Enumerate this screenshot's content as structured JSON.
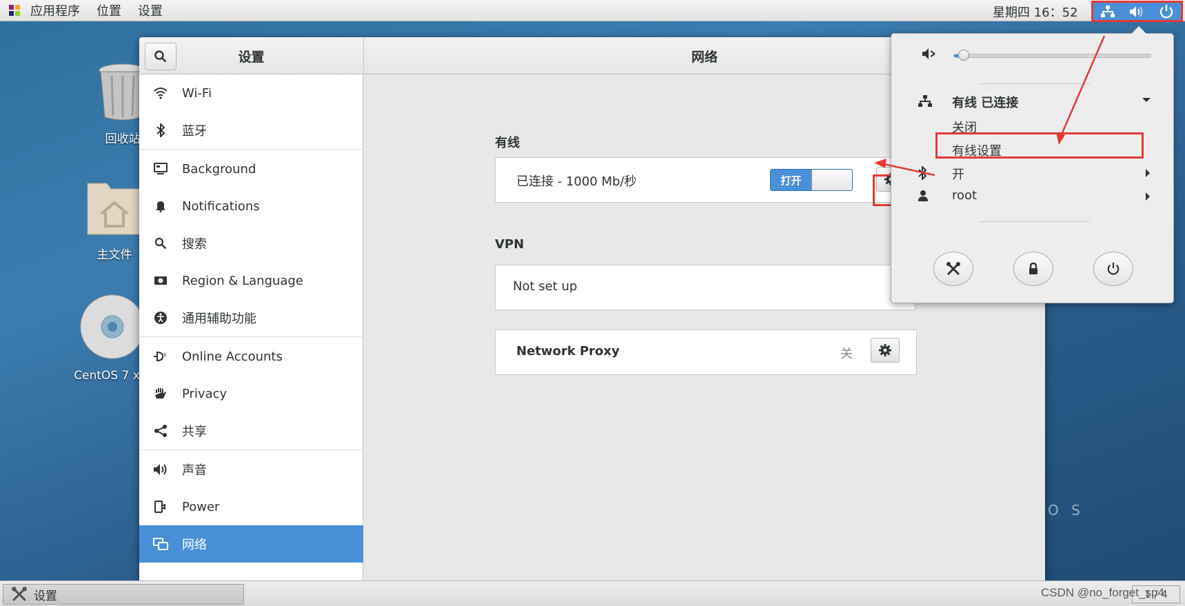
{
  "topbar": {
    "menus": [
      "应用程序",
      "位置",
      "设置"
    ],
    "clock": "星期四 16：52"
  },
  "desktop": {
    "icons": [
      "回收站",
      "主文件",
      "CentOS 7 x"
    ],
    "brand_fragment": "O S"
  },
  "window": {
    "sidebar_title": "设置",
    "main_title": "网络",
    "sidebar_items": [
      {
        "label": "Wi-Fi",
        "icon": "wifi-icon"
      },
      {
        "label": "蓝牙",
        "icon": "bluetooth-icon"
      },
      {
        "label": "Background",
        "icon": "background-icon"
      },
      {
        "label": "Notifications",
        "icon": "bell-icon"
      },
      {
        "label": "搜索",
        "icon": "search-icon"
      },
      {
        "label": "Region & Language",
        "icon": "region-icon"
      },
      {
        "label": "通用辅助功能",
        "icon": "accessibility-icon"
      },
      {
        "label": "Online Accounts",
        "icon": "online-accounts-icon"
      },
      {
        "label": "Privacy",
        "icon": "hand-icon"
      },
      {
        "label": "共享",
        "icon": "share-icon"
      },
      {
        "label": "声音",
        "icon": "speaker-icon"
      },
      {
        "label": "Power",
        "icon": "power-plug-icon"
      },
      {
        "label": "网络",
        "icon": "network-icon",
        "active": true
      }
    ],
    "wired": {
      "title": "有线",
      "status": "已连接 - 1000 Mb/秒",
      "toggle_on_label": "打开"
    },
    "vpn": {
      "title": "VPN",
      "status": "Not set up"
    },
    "proxy": {
      "label": "Network Proxy",
      "value": "关"
    }
  },
  "popover": {
    "volume_level": 0.05,
    "wired_label": "有线 已连接",
    "close_label": "关闭",
    "wired_settings_label": "有线设置",
    "bluetooth_label": "开",
    "user_label": "root"
  },
  "taskbar": {
    "task_label": "设置",
    "workspace": "1 / 4"
  },
  "watermark": "CSDN @no_forget_sp4",
  "colors": {
    "accent": "#4a90d9",
    "highlight_box": "#e53935"
  }
}
